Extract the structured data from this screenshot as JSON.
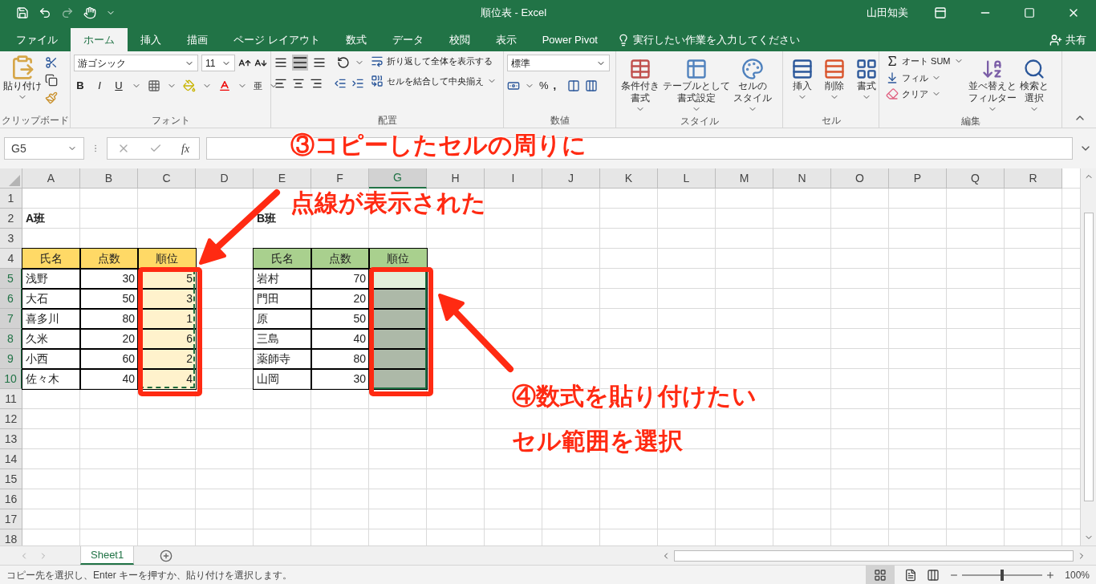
{
  "title_bar": {
    "title": "順位表 - Excel",
    "user": "山田知美"
  },
  "tabs": [
    {
      "label": "ファイル",
      "selected": false
    },
    {
      "label": "ホーム",
      "selected": true
    },
    {
      "label": "挿入",
      "selected": false
    },
    {
      "label": "描画",
      "selected": false
    },
    {
      "label": "ページ レイアウト",
      "selected": false
    },
    {
      "label": "数式",
      "selected": false
    },
    {
      "label": "データ",
      "selected": false
    },
    {
      "label": "校閲",
      "selected": false
    },
    {
      "label": "表示",
      "selected": false
    },
    {
      "label": "Power Pivot",
      "selected": false
    }
  ],
  "tell_me": {
    "placeholder": "実行したい作業を入力してください"
  },
  "share": "共有",
  "clipboard": {
    "paste": "貼り付け",
    "label": "クリップボード"
  },
  "font": {
    "name": "游ゴシック",
    "size": "11",
    "bold": "B",
    "italic": "I",
    "underline": "U",
    "phonetic": "亜",
    "label": "フォント"
  },
  "alignment": {
    "wrap": "折り返して全体を表示する",
    "merge": "セルを結合して中央揃え",
    "label": "配置"
  },
  "number": {
    "format": "標準",
    "percent": "%",
    "comma": ",",
    "label": "数値"
  },
  "styles": {
    "buttons": [
      {
        "lines": [
          "条件付き",
          "書式"
        ]
      },
      {
        "lines": [
          "テーブルとして",
          "書式設定"
        ]
      },
      {
        "lines": [
          "セルの",
          "スタイル"
        ]
      }
    ],
    "label": "スタイル"
  },
  "cells_group": {
    "buttons": [
      {
        "lines": [
          "挿入"
        ]
      },
      {
        "lines": [
          "削除"
        ]
      },
      {
        "lines": [
          "書式"
        ]
      }
    ],
    "label": "セル"
  },
  "editing": {
    "autosum": "オート SUM",
    "fill": "フィル",
    "clear": "クリア",
    "buttons": [
      {
        "lines": [
          "並べ替えと",
          "フィルター"
        ]
      },
      {
        "lines": [
          "検索と",
          "選択"
        ]
      }
    ],
    "label": "編集"
  },
  "formula_bar": {
    "name_box": "G5",
    "fx": "fx"
  },
  "sheet": {
    "columns": [
      {
        "label": "A",
        "selected": false
      },
      {
        "label": "B",
        "selected": false
      },
      {
        "label": "C",
        "selected": false
      },
      {
        "label": "D",
        "selected": false
      },
      {
        "label": "E",
        "selected": false
      },
      {
        "label": "F",
        "selected": false
      },
      {
        "label": "G",
        "selected": true
      },
      {
        "label": "H",
        "selected": false
      },
      {
        "label": "I",
        "selected": false
      },
      {
        "label": "J",
        "selected": false
      },
      {
        "label": "K",
        "selected": false
      },
      {
        "label": "L",
        "selected": false
      },
      {
        "label": "M",
        "selected": false
      },
      {
        "label": "N",
        "selected": false
      },
      {
        "label": "O",
        "selected": false
      },
      {
        "label": "P",
        "selected": false
      },
      {
        "label": "Q",
        "selected": false
      },
      {
        "label": "R",
        "selected": false
      }
    ],
    "rows": [
      {
        "label": "1",
        "selected": false
      },
      {
        "label": "2",
        "selected": false,
        "cells": {
          "A": {
            "text": "A班",
            "kind": "title",
            "copied": false
          },
          "E": {
            "text": "B班",
            "kind": "title",
            "copied": false
          }
        }
      },
      {
        "label": "3",
        "selected": false
      },
      {
        "label": "4",
        "selected": false,
        "cells": {
          "A": {
            "text": "氏名",
            "kind": "header",
            "color": "#ffd966",
            "copied": false
          },
          "B": {
            "text": "点数",
            "kind": "header",
            "color": "#ffd966",
            "copied": false
          },
          "C": {
            "text": "順位",
            "kind": "header",
            "color": "#ffd966",
            "copied": false
          },
          "E": {
            "text": "氏名",
            "kind": "header",
            "color": "#a9d08e",
            "copied": false
          },
          "F": {
            "text": "点数",
            "kind": "header",
            "color": "#a9d08e",
            "copied": false
          },
          "G": {
            "text": "順位",
            "kind": "header",
            "color": "#a9d08e",
            "copied": false
          }
        }
      },
      {
        "label": "5",
        "selected": true,
        "cells": {
          "A": {
            "text": "浅野",
            "kind": "text",
            "copied": false
          },
          "B": {
            "text": "30",
            "kind": "number",
            "copied": false
          },
          "C": {
            "text": "5",
            "kind": "number",
            "color": "#fff2cc",
            "copied": true
          },
          "E": {
            "text": "岩村",
            "kind": "text",
            "copied": false
          },
          "F": {
            "text": "70",
            "kind": "number",
            "copied": false
          },
          "G": {
            "kind": "blank",
            "copied": false
          }
        }
      },
      {
        "label": "6",
        "selected": true,
        "cells": {
          "A": {
            "text": "大石",
            "kind": "text",
            "copied": false
          },
          "B": {
            "text": "50",
            "kind": "number",
            "copied": false
          },
          "C": {
            "text": "3",
            "kind": "number",
            "color": "#fff2cc",
            "copied": true
          },
          "E": {
            "text": "門田",
            "kind": "text",
            "copied": false
          },
          "F": {
            "text": "20",
            "kind": "number",
            "copied": false
          },
          "G": {
            "kind": "blank",
            "copied": false
          }
        }
      },
      {
        "label": "7",
        "selected": true,
        "cells": {
          "A": {
            "text": "喜多川",
            "kind": "text",
            "copied": false
          },
          "B": {
            "text": "80",
            "kind": "number",
            "copied": false
          },
          "C": {
            "text": "1",
            "kind": "number",
            "color": "#fff2cc",
            "copied": true
          },
          "E": {
            "text": "原",
            "kind": "text",
            "copied": false
          },
          "F": {
            "text": "50",
            "kind": "number",
            "copied": false
          },
          "G": {
            "kind": "blank",
            "copied": false
          }
        }
      },
      {
        "label": "8",
        "selected": true,
        "cells": {
          "A": {
            "text": "久米",
            "kind": "text",
            "copied": false
          },
          "B": {
            "text": "20",
            "kind": "number",
            "copied": false
          },
          "C": {
            "text": "6",
            "kind": "number",
            "color": "#fff2cc",
            "copied": true
          },
          "E": {
            "text": "三島",
            "kind": "text",
            "copied": false
          },
          "F": {
            "text": "40",
            "kind": "number",
            "copied": false
          },
          "G": {
            "kind": "blank",
            "copied": false
          }
        }
      },
      {
        "label": "9",
        "selected": true,
        "cells": {
          "A": {
            "text": "小西",
            "kind": "text",
            "copied": false
          },
          "B": {
            "text": "60",
            "kind": "number",
            "copied": false
          },
          "C": {
            "text": "2",
            "kind": "number",
            "color": "#fff2cc",
            "copied": true
          },
          "E": {
            "text": "薬師寺",
            "kind": "text",
            "copied": false
          },
          "F": {
            "text": "80",
            "kind": "number",
            "copied": false
          },
          "G": {
            "kind": "blank",
            "copied": false
          }
        }
      },
      {
        "label": "10",
        "selected": true,
        "cells": {
          "A": {
            "text": "佐々木",
            "kind": "text",
            "copied": false
          },
          "B": {
            "text": "40",
            "kind": "number",
            "copied": false
          },
          "C": {
            "text": "4",
            "kind": "number",
            "color": "#fff2cc",
            "copied": true
          },
          "E": {
            "text": "山岡",
            "kind": "text",
            "copied": false
          },
          "F": {
            "text": "30",
            "kind": "number",
            "copied": false
          },
          "G": {
            "kind": "blank",
            "copied": false
          }
        }
      },
      {
        "label": "11",
        "selected": false
      },
      {
        "label": "12",
        "selected": false
      },
      {
        "label": "13",
        "selected": false
      },
      {
        "label": "14",
        "selected": false
      },
      {
        "label": "15",
        "selected": false
      },
      {
        "label": "16",
        "selected": false
      },
      {
        "label": "17",
        "selected": false
      },
      {
        "label": "18",
        "selected": false
      }
    ]
  },
  "sheet_tabs": [
    {
      "label": "Sheet1",
      "selected": true
    }
  ],
  "status_bar": {
    "message": "コピー先を選択し、Enter キーを押すか、貼り付けを選択します。",
    "zoom": {
      "level": 0.5
    },
    "zoom_text": "100%"
  },
  "annotations": [
    {
      "lines": [
        "③コピーしたセルの周りに",
        "点線が表示された"
      ]
    },
    {
      "lines": [
        "④数式を貼り付けたい",
        "セル範囲を選択"
      ]
    }
  ]
}
